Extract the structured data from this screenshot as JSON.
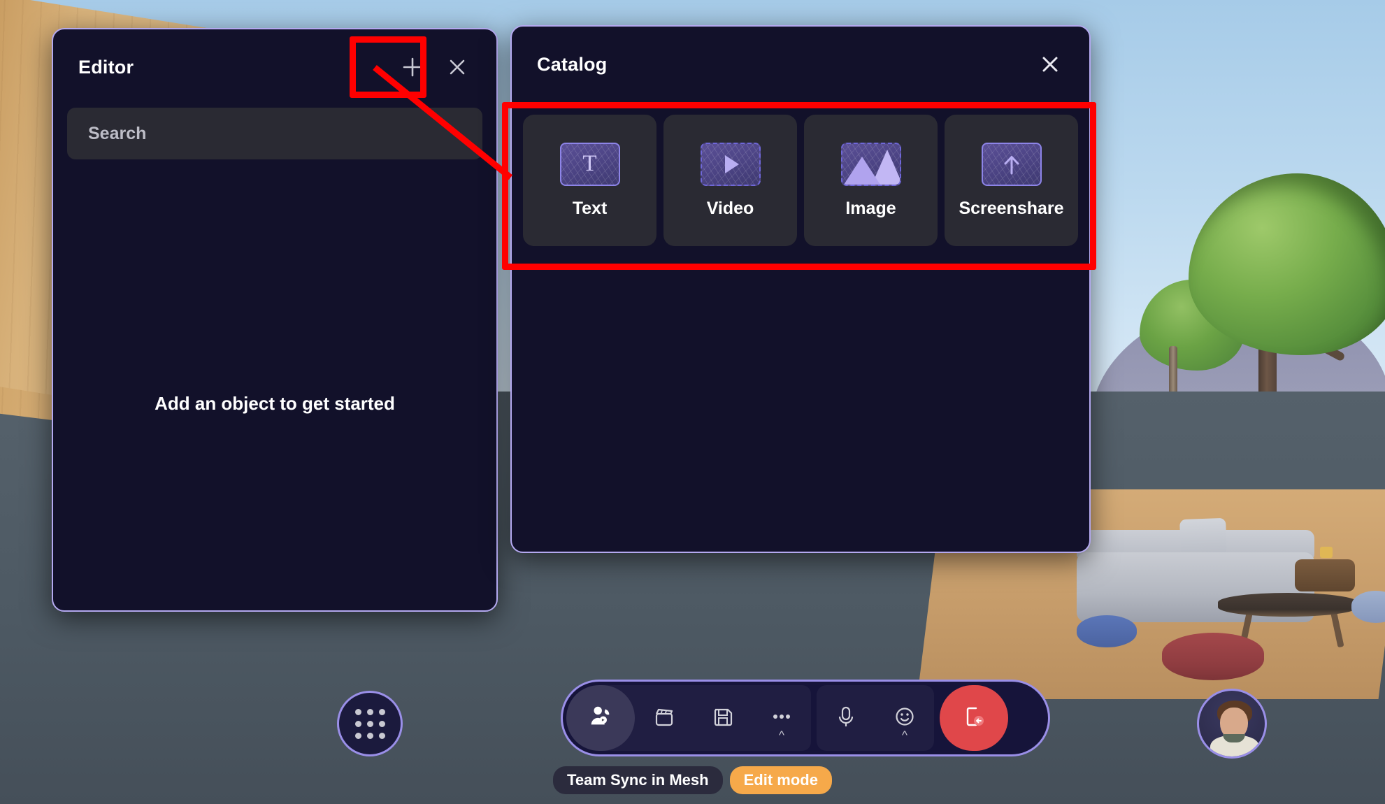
{
  "scene": {
    "name": "mesh-immersive-space",
    "colors": {
      "panel_bg": "#12112a",
      "panel_border": "#b4a9f0",
      "tile_bg": "#2a2a33",
      "accent_purple": "#8d84e8",
      "annotation_red": "#ff0000",
      "edit_mode_orange": "#f6a council",
      "leave_red": "#e0474a"
    }
  },
  "editor": {
    "title": "Editor",
    "add_icon": "plus-icon",
    "close_icon": "close-icon",
    "search": {
      "placeholder": "Search",
      "value": ""
    },
    "empty_state": "Add an object to get started"
  },
  "catalog": {
    "title": "Catalog",
    "close_icon": "close-icon",
    "items": [
      {
        "label": "Text",
        "icon": "text-icon",
        "border": "solid"
      },
      {
        "label": "Video",
        "icon": "video-play-icon",
        "border": "dashed"
      },
      {
        "label": "Image",
        "icon": "image-icon",
        "border": "dashed"
      },
      {
        "label": "Screenshare",
        "icon": "arrow-up-icon",
        "border": "solid"
      }
    ]
  },
  "annotations": [
    {
      "name": "highlight-add-button",
      "shape": "rectangle",
      "color": "#ff0000"
    },
    {
      "name": "highlight-catalog-row",
      "shape": "rectangle",
      "color": "#ff0000"
    },
    {
      "name": "connector-line",
      "shape": "line",
      "color": "#ff0000"
    }
  ],
  "bottom_bar": {
    "apps_button": {
      "icon": "grid-dots-icon",
      "label": "Apps"
    },
    "toolbar_group_1": [
      {
        "icon": "people-icon",
        "label": "Participants",
        "active": true,
        "has_chevron": false
      },
      {
        "icon": "clapboard-icon",
        "label": "Scene",
        "active": false,
        "has_chevron": false
      },
      {
        "icon": "save-icon",
        "label": "Save",
        "active": false,
        "has_chevron": false
      },
      {
        "icon": "more-icon",
        "label": "More",
        "active": false,
        "has_chevron": true
      }
    ],
    "toolbar_group_2": [
      {
        "icon": "microphone-icon",
        "label": "Mic",
        "active": false,
        "has_chevron": false
      },
      {
        "icon": "emoji-icon",
        "label": "Reaction",
        "active": false,
        "has_chevron": true
      }
    ],
    "leave_button": {
      "icon": "leave-icon",
      "label": "Leave"
    },
    "avatar": {
      "name": "user-avatar"
    }
  },
  "status": {
    "session_name": "Team Sync in Mesh",
    "mode_badge": "Edit mode"
  }
}
